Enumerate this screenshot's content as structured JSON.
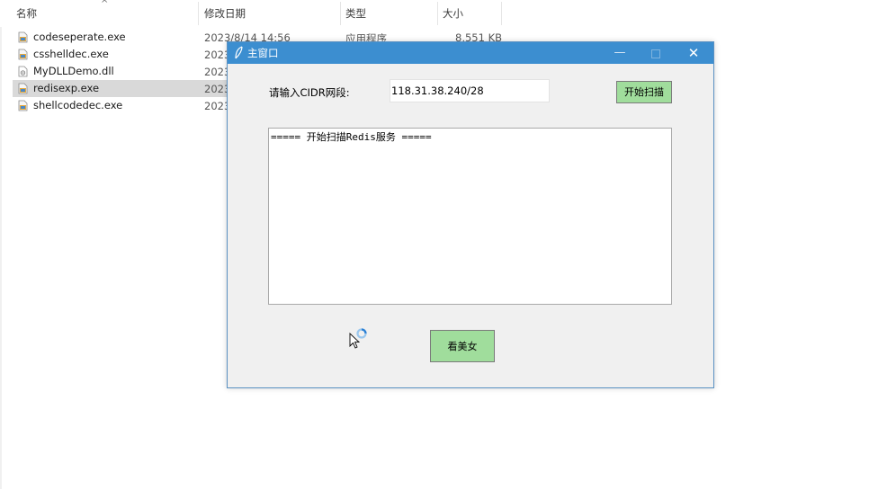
{
  "explorer": {
    "columns": {
      "name": "名称",
      "date": "修改日期",
      "type": "类型",
      "size": "大小"
    },
    "sort_arrow": "^",
    "files": [
      {
        "name": "codeseperate.exe",
        "date": "2023/8/14 14:56",
        "type": "应用程序",
        "size": "8,551 KB",
        "icon": "exe-icon"
      },
      {
        "name": "csshelldec.exe",
        "date": "2023",
        "type": "",
        "size": "",
        "icon": "exe-icon"
      },
      {
        "name": "MyDLLDemo.dll",
        "date": "2023",
        "type": "",
        "size": "",
        "icon": "dll-icon"
      },
      {
        "name": "redisexp.exe",
        "date": "2023",
        "type": "",
        "size": "",
        "icon": "exe-icon",
        "selected": true
      },
      {
        "name": "shellcodedec.exe",
        "date": "2023",
        "type": "",
        "size": "",
        "icon": "exe-icon"
      }
    ]
  },
  "window": {
    "title": "主窗口",
    "title_icon": "feather-icon",
    "controls": {
      "minimize": "—",
      "close": "✕"
    },
    "cidr_label": "请输入CIDR网段:",
    "cidr_value": "118.31.38.240/28",
    "scan_button": "开始扫描",
    "output_text": "===== 开始扫描Redis服务 =====",
    "girl_button": "看美女",
    "accent_color": "#3c8ed0",
    "button_color": "#a0dd9c"
  }
}
